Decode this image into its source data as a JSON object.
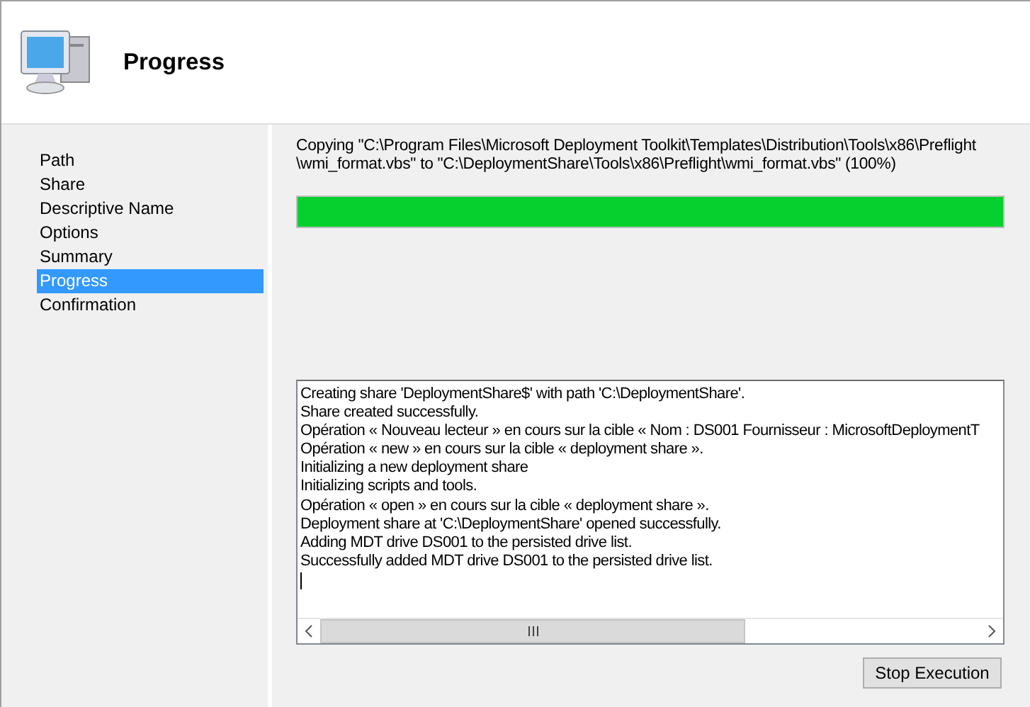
{
  "header": {
    "title": "Progress"
  },
  "sidebar": {
    "items": [
      {
        "label": "Path",
        "selected": false
      },
      {
        "label": "Share",
        "selected": false
      },
      {
        "label": "Descriptive Name",
        "selected": false
      },
      {
        "label": "Options",
        "selected": false
      },
      {
        "label": "Summary",
        "selected": false
      },
      {
        "label": "Progress",
        "selected": true
      },
      {
        "label": "Confirmation",
        "selected": false
      }
    ]
  },
  "status": "Copying \"C:\\Program Files\\Microsoft Deployment Toolkit\\Templates\\Distribution\\Tools\\x86\\Preflight \\wmi_format.vbs\" to \"C:\\DeploymentShare\\Tools\\x86\\Preflight\\wmi_format.vbs\" (100%)",
  "progress": {
    "level": 1
  },
  "log": {
    "lines": [
      "Creating share 'DeploymentShare$' with path 'C:\\DeploymentShare'.",
      "Share created successfully.",
      "Opération « Nouveau lecteur » en cours sur la cible « Nom : DS001 Fournisseur : MicrosoftDeploymentT",
      "Opération « new » en cours sur la cible « deployment share ».",
      "Initializing a new deployment share",
      "Initializing scripts and tools.",
      "Opération « open » en cours sur la cible « deployment share ».",
      "Deployment share at 'C:\\DeploymentShare' opened successfully.",
      "Adding MDT drive DS001 to the persisted drive list.",
      "Successfully added MDT drive DS001 to the persisted drive list."
    ]
  },
  "buttons": [
    {
      "label": "Stop Execution"
    }
  ]
}
